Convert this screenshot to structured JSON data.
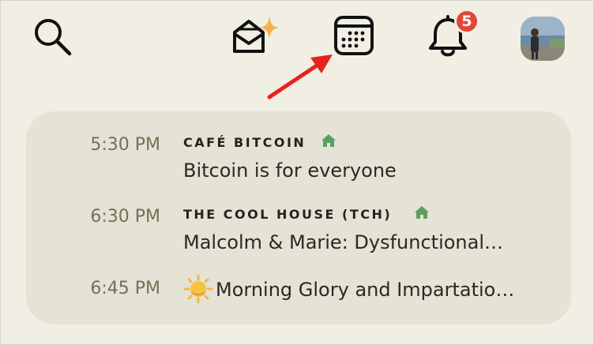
{
  "header": {
    "icons": [
      "search-icon",
      "invite-envelope-icon",
      "calendar-icon",
      "bell-icon",
      "avatar"
    ],
    "notification_count": "5",
    "colors": {
      "badge": "#e2463a",
      "sparkle": "#f2b24e",
      "arrow": "#e5241d",
      "house": "#5aa061"
    }
  },
  "events": [
    {
      "time": "5:30 PM",
      "club": "CAFÉ BITCOIN",
      "title": "Bitcoin is for everyone"
    },
    {
      "time": "6:30 PM",
      "club": "THE COOL HOUSE (TCH)",
      "title": "Malcolm & Marie: Dysfunctional…"
    },
    {
      "time": "6:45 PM",
      "title": "Morning Glory and Impartatio…"
    }
  ]
}
